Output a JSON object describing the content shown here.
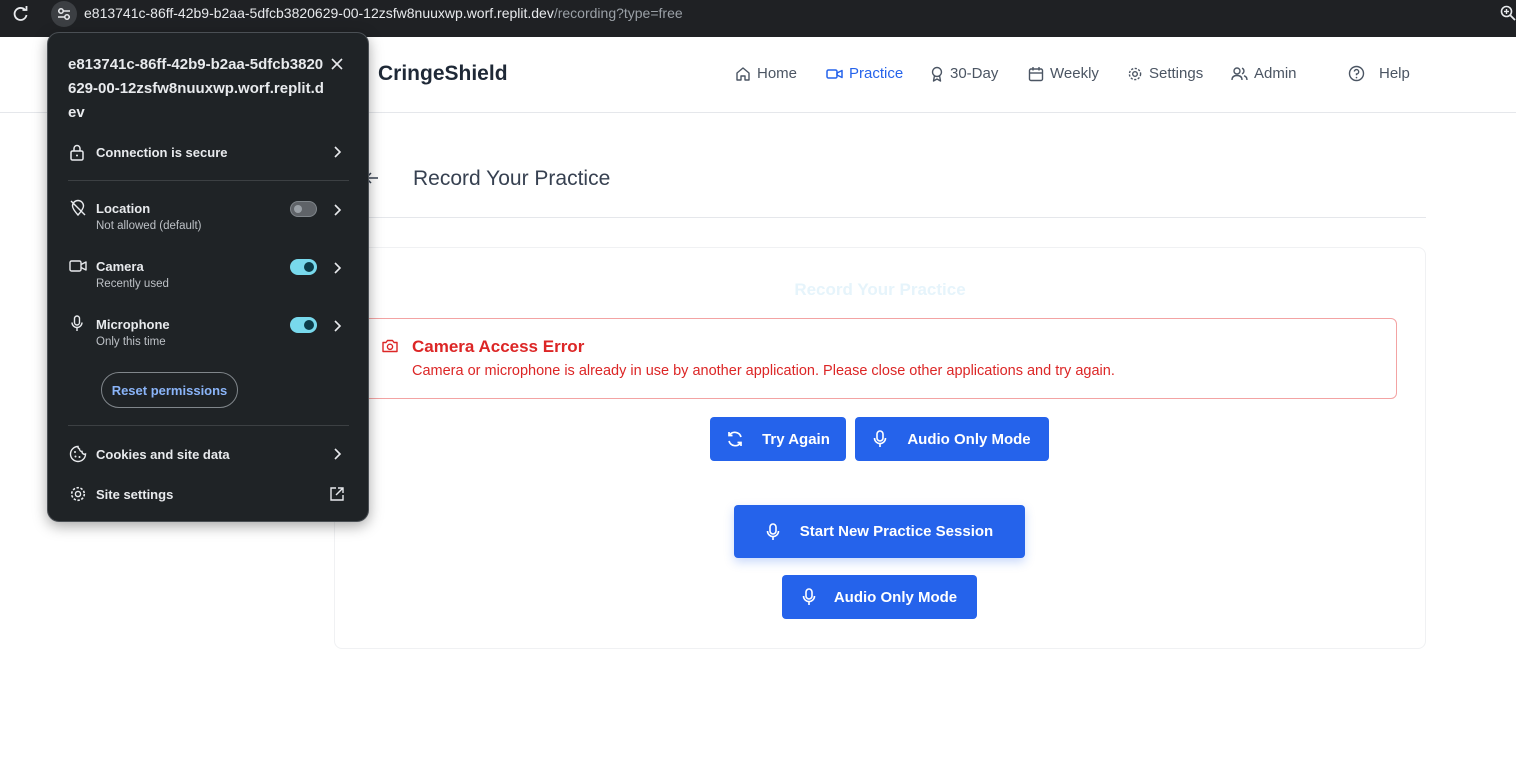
{
  "browser": {
    "url_host": "e813741c-86ff-42b9-b2aa-5dfcb3820629-00-12zsfw8nuuxwp.worf.replit.dev",
    "url_path": "/recording?type=free"
  },
  "header": {
    "brand": "CringeShield",
    "nav": [
      {
        "label": "Home",
        "icon": "home-icon"
      },
      {
        "label": "Practice",
        "icon": "video-icon",
        "active": true
      },
      {
        "label": "30-Day",
        "icon": "award-icon"
      },
      {
        "label": "Weekly",
        "icon": "calendar-icon"
      },
      {
        "label": "Settings",
        "icon": "gear-icon"
      },
      {
        "label": "Admin",
        "icon": "users-icon"
      },
      {
        "label": "Help",
        "icon": "help-circle-icon"
      }
    ]
  },
  "page": {
    "title": "Record Your Practice",
    "card_title": "Record Your Practice"
  },
  "error": {
    "title": "Camera Access Error",
    "message": "Camera or microphone is already in use by another application. Please close other applications and try again."
  },
  "buttons": {
    "try_again": "Try Again",
    "audio_only_1": "Audio Only Mode",
    "start_session": "Start New Practice Session",
    "audio_only_2": "Audio Only Mode"
  },
  "popup": {
    "host": "e813741c-86ff-42b9-b2aa-5dfcb3820629-00-12zsfw8nuuxwp.worf.replit.dev",
    "connection": "Connection is secure",
    "location": {
      "label": "Location",
      "status": "Not allowed (default)",
      "enabled": false
    },
    "camera": {
      "label": "Camera",
      "status": "Recently used",
      "enabled": true
    },
    "microphone": {
      "label": "Microphone",
      "status": "Only this time",
      "enabled": true
    },
    "reset": "Reset permissions",
    "cookies": "Cookies and site data",
    "site_settings": "Site settings"
  },
  "colors": {
    "primary": "#2563eb",
    "error": "#dc2626",
    "popup_bg": "#1f2326",
    "toggle_on": "#78d9ec"
  }
}
